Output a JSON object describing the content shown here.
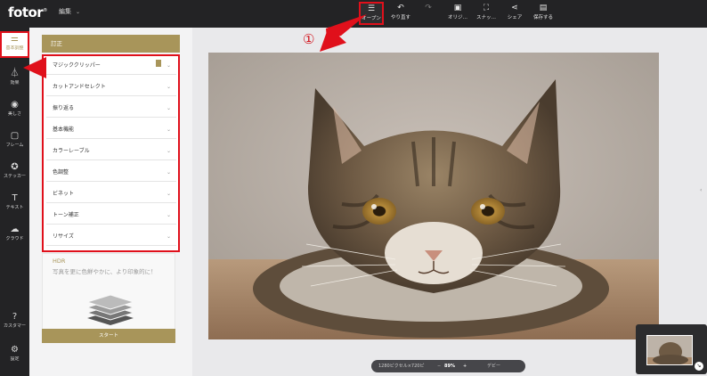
{
  "app": {
    "logo": "fotor",
    "logo_mark": "®"
  },
  "topbar": {
    "edit_menu": "編集",
    "tools": [
      {
        "name": "open",
        "label": "オープン",
        "icon": "menu-icon"
      },
      {
        "name": "undo",
        "label": "やり直す",
        "icon": "undo-icon"
      },
      {
        "name": "redo",
        "label": "",
        "icon": "redo-icon"
      },
      {
        "name": "original",
        "label": "オリジ…",
        "icon": "image-icon"
      },
      {
        "name": "snapshot",
        "label": "スナッ…",
        "icon": "snapshot-icon"
      },
      {
        "name": "share",
        "label": "シェア",
        "icon": "share-icon"
      },
      {
        "name": "save",
        "label": "保存する",
        "icon": "save-icon"
      }
    ]
  },
  "rail": {
    "items": [
      {
        "label": "基本調整",
        "icon": "sliders-icon"
      },
      {
        "label": "効果",
        "icon": "flask-icon"
      },
      {
        "label": "美しさ",
        "icon": "eye-icon"
      },
      {
        "label": "フレーム",
        "icon": "frame-icon"
      },
      {
        "label": "ステッカー",
        "icon": "star-icon"
      },
      {
        "label": "テキスト",
        "icon": "text-icon"
      },
      {
        "label": "クラウド",
        "icon": "cloud-icon"
      },
      {
        "label": "カスタマー",
        "icon": "help-icon"
      },
      {
        "label": "設定",
        "icon": "settings-icon"
      }
    ]
  },
  "panel": {
    "header": "訂正",
    "items": [
      "マジッククリッパー",
      "カットアンドセレクト",
      "振り返る",
      "基本機能",
      "カラーレーブル",
      "色調整",
      "ビネット",
      "トーン補正",
      "リサイズ"
    ],
    "hdr_title": "HDR",
    "hdr_desc": "写真を更に色鮮やかに、より印象的に！",
    "start_label": "スタート"
  },
  "status": {
    "resolution": "1280ピクセル×720ピ",
    "zoom_out": "−",
    "zoom": "89%",
    "zoom_in": "+",
    "compare": "デビー"
  },
  "annotation": {
    "number": "①"
  },
  "colors": {
    "accent": "#a8955a",
    "highlight": "#e0101b",
    "dark": "#232325"
  }
}
